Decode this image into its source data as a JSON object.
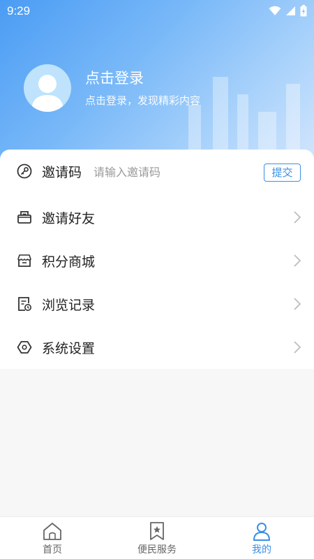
{
  "status_bar": {
    "time": "9:29"
  },
  "profile": {
    "title": "点击登录",
    "subtitle": "点击登录，发现精彩内容"
  },
  "invite": {
    "label": "邀请码",
    "placeholder": "请输入邀请码",
    "value": "",
    "submit_label": "提交"
  },
  "menu": [
    {
      "label": "邀请好友",
      "icon": "mail-icon"
    },
    {
      "label": "积分商城",
      "icon": "store-icon"
    },
    {
      "label": "浏览记录",
      "icon": "history-icon"
    },
    {
      "label": "系统设置",
      "icon": "settings-hexagon-icon"
    }
  ],
  "tabbar": {
    "tabs": [
      {
        "label": "首页",
        "icon": "home-icon",
        "active": false
      },
      {
        "label": "便民服务",
        "icon": "bookmark-star-icon",
        "active": false
      },
      {
        "label": "我的",
        "icon": "user-icon",
        "active": true
      }
    ]
  },
  "colors": {
    "accent": "#3a8fe6",
    "header_gradient_start": "#4a9cf4",
    "header_gradient_end": "#d8e8fd",
    "background": "#f7f7f7"
  }
}
